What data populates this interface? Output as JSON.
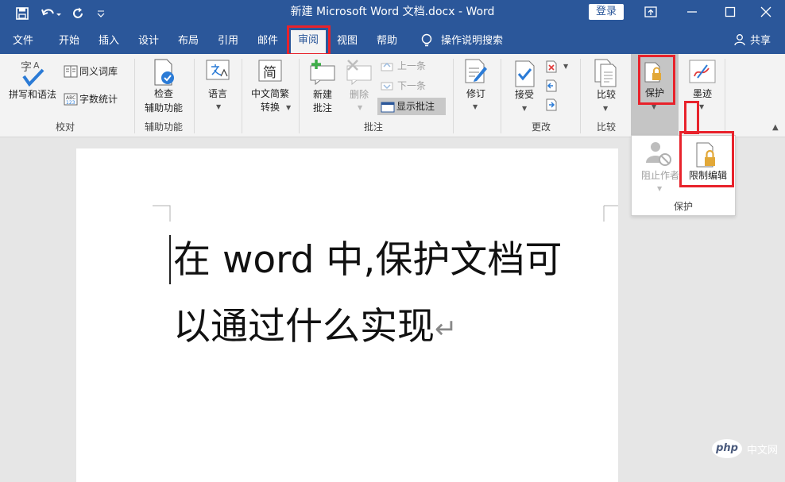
{
  "window": {
    "title": "新建 Microsoft Word 文档.docx  -  Word",
    "login_label": "登录",
    "colors": {
      "title_bar": "#2b579a",
      "ribbon": "#f3f3f3",
      "highlight": "#e8222b"
    }
  },
  "quick_access": {
    "icons": [
      "save-icon",
      "undo-icon",
      "redo-icon",
      "customize-icon"
    ]
  },
  "window_controls": {
    "icons": [
      "ribbon-display-icon",
      "minimize-icon",
      "maximize-icon",
      "close-icon"
    ]
  },
  "tabs": [
    {
      "label": "文件"
    },
    {
      "label": "开始"
    },
    {
      "label": "插入"
    },
    {
      "label": "设计"
    },
    {
      "label": "布局"
    },
    {
      "label": "引用"
    },
    {
      "label": "邮件"
    },
    {
      "label": "审阅",
      "active": true
    },
    {
      "label": "视图"
    },
    {
      "label": "帮助"
    }
  ],
  "tell_me": "操作说明搜索",
  "share": "共享",
  "ribbon": {
    "proofing": {
      "spelling": "拼写和语法",
      "thesaurus": "同义词库",
      "word_count": "字数统计",
      "group": "校对"
    },
    "accessibility": {
      "check_line1": "检查",
      "check_line2": "辅助功能",
      "group": "辅助功能"
    },
    "language": {
      "label": "语言"
    },
    "chinese": {
      "glyph": "简",
      "line1": "中文简繁",
      "line2": "转换"
    },
    "comments": {
      "new_line1": "新建",
      "new_line2": "批注",
      "delete": "删除",
      "previous": "上一条",
      "next": "下一条",
      "show": "显示批注",
      "group": "批注"
    },
    "tracking": {
      "label": "修订"
    },
    "changes": {
      "accept": "接受",
      "group": "更改"
    },
    "compare": {
      "label": "比较",
      "group": "比较"
    },
    "protect": {
      "label": "保护"
    },
    "ink": {
      "label": "墨迹"
    }
  },
  "protect_menu": {
    "block_authors": "阻止作者",
    "restrict_editing": "限制编辑",
    "group": "保护"
  },
  "document": {
    "line1": "在 word 中,保护文档可",
    "line2": "以通过什么实现",
    "paragraph_mark": "↵"
  },
  "watermark": {
    "badge": "php",
    "text": "中文网"
  }
}
